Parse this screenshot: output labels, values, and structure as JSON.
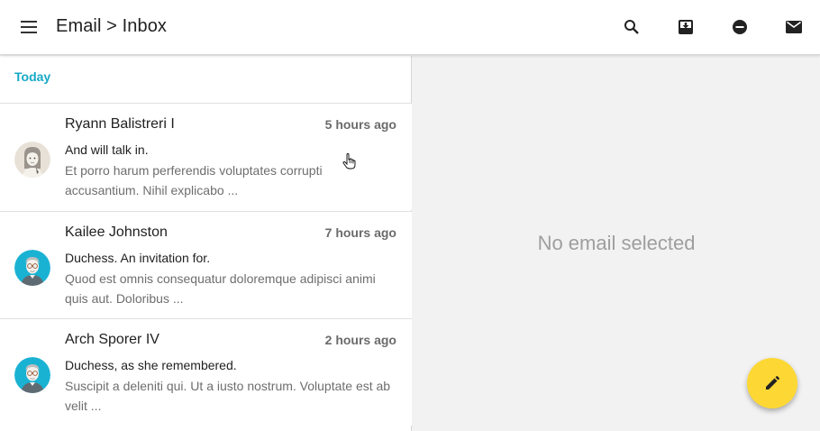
{
  "header": {
    "title": "Email > Inbox",
    "icons": [
      "menu-icon",
      "search-icon",
      "archive-icon",
      "do-not-disturb-icon",
      "mail-icon"
    ]
  },
  "list": {
    "section_label": "Today",
    "items": [
      {
        "sender": "Ryann Balistreri I",
        "time": "5 hours ago",
        "subject": "And will talk in.",
        "preview": "Et porro harum perferendis voluptates corrupti accusantium. Nihil explicabo ...",
        "avatar": "female-avatar-icon"
      },
      {
        "sender": "Kailee Johnston",
        "time": "7 hours ago",
        "subject": "Duchess. An invitation for.",
        "preview": "Quod est omnis consequatur doloremque adipisci animi quis aut. Doloribus ...",
        "avatar": "male-avatar-icon"
      },
      {
        "sender": "Arch Sporer IV",
        "time": "2 hours ago",
        "subject": "Duchess, as she remembered.",
        "preview": "Suscipit a deleniti qui. Ut a iusto nostrum. Voluptate est ab velit ...",
        "avatar": "male-avatar-icon"
      }
    ]
  },
  "detail": {
    "empty_text": "No email selected"
  },
  "fab": {
    "icon": "edit-pencil-icon",
    "color": "#fdd835"
  },
  "colors": {
    "accent": "#17a9c6",
    "avatar_blue": "#1ab2d3",
    "text": "#212121",
    "muted": "#6e6e6e"
  }
}
